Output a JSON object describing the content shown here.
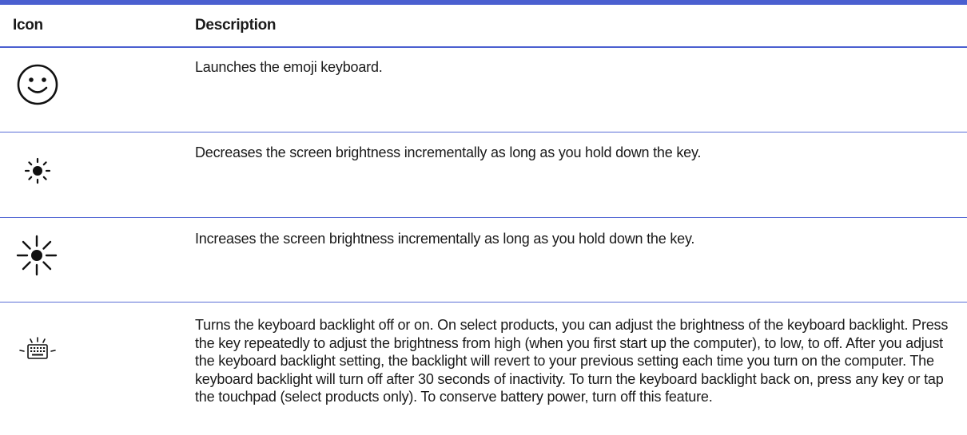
{
  "table": {
    "headers": {
      "icon": "Icon",
      "description": "Description"
    },
    "rows": [
      {
        "icon": "emoji-face-icon",
        "description": "Launches the emoji keyboard."
      },
      {
        "icon": "brightness-down-icon",
        "description": "Decreases the screen brightness incrementally as long as you hold down the key."
      },
      {
        "icon": "brightness-up-icon",
        "description": "Increases the screen brightness incrementally as long as you hold down the key."
      },
      {
        "icon": "keyboard-backlight-icon",
        "description": "Turns the keyboard backlight off or on. On select products, you can adjust the brightness of the keyboard backlight. Press the key repeatedly to adjust the brightness from high (when you first start up the computer), to low, to off. After you adjust the keyboard backlight setting, the backlight will revert to your previous setting each time you turn on the computer. The keyboard backlight will turn off after 30 seconds of inactivity. To turn the keyboard backlight back on, press any key or tap the touchpad (select products only). To conserve battery power, turn off this feature."
      }
    ]
  },
  "colors": {
    "rule": "#4a5fd0",
    "text": "#1a1a1a"
  }
}
